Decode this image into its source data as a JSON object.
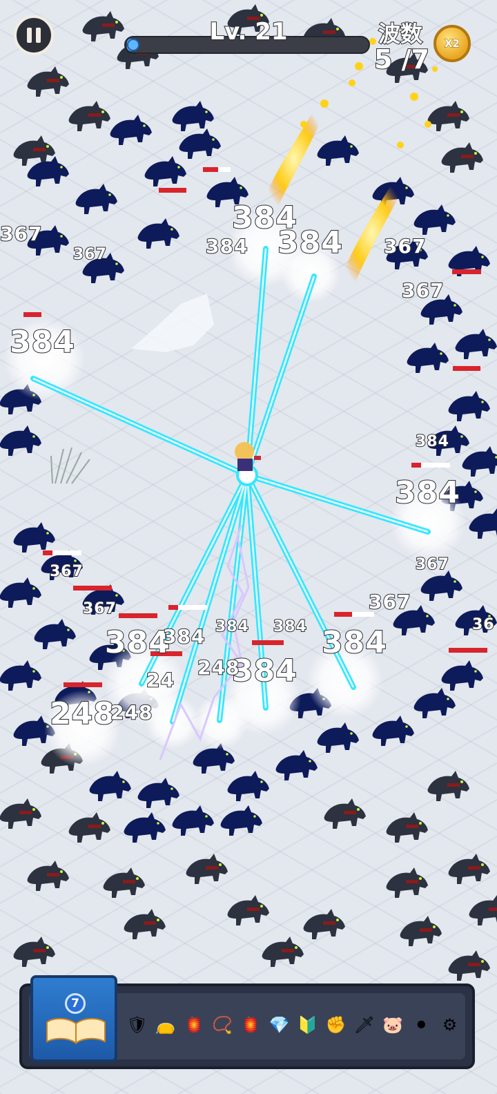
{
  "hud": {
    "level_label": "Lv. 21",
    "level_progress_percent": 3,
    "wave_title": "波数",
    "wave_count": "5 /7",
    "speed_label": "X2"
  },
  "colors": {
    "laser": "#35e7ff",
    "wolf": "#0d1b5a",
    "wolf_dark": "#2c323f",
    "snow": "#e3e7ee",
    "fire": "#ffcc1a"
  },
  "damage_numbers": [
    {
      "text": "384",
      "size": "big"
    },
    {
      "text": "384",
      "size": "mid"
    },
    {
      "text": "384",
      "size": "big"
    },
    {
      "text": "367",
      "size": "mid"
    },
    {
      "text": "367",
      "size": "small"
    },
    {
      "text": "367",
      "size": "mid"
    },
    {
      "text": "384",
      "size": "big"
    },
    {
      "text": "367",
      "size": "mid"
    },
    {
      "text": "384",
      "size": "small"
    },
    {
      "text": "384",
      "size": "big"
    },
    {
      "text": "367",
      "size": "small"
    },
    {
      "text": "367",
      "size": "mid"
    },
    {
      "text": "367",
      "size": "small"
    },
    {
      "text": "367",
      "size": "small"
    },
    {
      "text": "384",
      "size": "big"
    },
    {
      "text": "384",
      "size": "mid"
    },
    {
      "text": "384",
      "size": "small"
    },
    {
      "text": "384",
      "size": "small"
    },
    {
      "text": "384",
      "size": "big"
    },
    {
      "text": "384",
      "size": "big"
    },
    {
      "text": "248",
      "size": "mid"
    },
    {
      "text": "24",
      "size": "mid"
    },
    {
      "text": "248",
      "size": "big"
    },
    {
      "text": "248",
      "size": "mid"
    },
    {
      "text": "36",
      "size": "small"
    }
  ],
  "skill_bar": {
    "book_level": "7",
    "icons": [
      "armor-icon",
      "pouch-icon",
      "lantern-icon",
      "amulet-icon",
      "lantern-icon",
      "crystal-icon",
      "shield-icon",
      "gauntlet-icon",
      "sword-icon",
      "piggy-bank-icon",
      "cannon-icon",
      "trap-icon"
    ]
  }
}
